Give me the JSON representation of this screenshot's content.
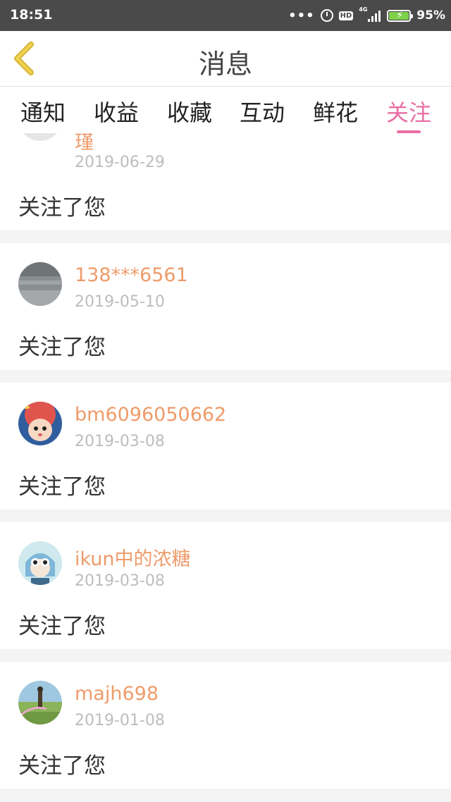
{
  "status_bar": {
    "time": "18:51",
    "dots": "•••",
    "hd": "HD",
    "network": "4G",
    "battery": "95%",
    "icons": [
      "alarm-icon",
      "signal-icon",
      "battery-charging-icon"
    ]
  },
  "header": {
    "title": "消息",
    "back_icon": "chevron-left-icon"
  },
  "tabs": [
    {
      "label": "通知"
    },
    {
      "label": "收益"
    },
    {
      "label": "收藏"
    },
    {
      "label": "互动"
    },
    {
      "label": "鲜花"
    },
    {
      "label": "关注",
      "active": true
    }
  ],
  "items": [
    {
      "username": "瑾",
      "date": "2019-06-29",
      "message": "关注了您"
    },
    {
      "username": "138***6561",
      "date": "2019-05-10",
      "message": "关注了您"
    },
    {
      "username": "bm6096050662",
      "date": "2019-03-08",
      "message": "关注了您"
    },
    {
      "username": "ikun中的浓糖",
      "date": "2019-03-08",
      "message": "关注了您"
    },
    {
      "username": "majh698",
      "date": "2019-01-08",
      "message": "关注了您"
    }
  ],
  "colors": {
    "accent": "#e86fa4",
    "username": "#ee9b6a",
    "date": "#bdbdbd",
    "status_bar": "#4a4a4a",
    "back_arrow": "#f0d24e",
    "battery": "#7fd14a"
  }
}
